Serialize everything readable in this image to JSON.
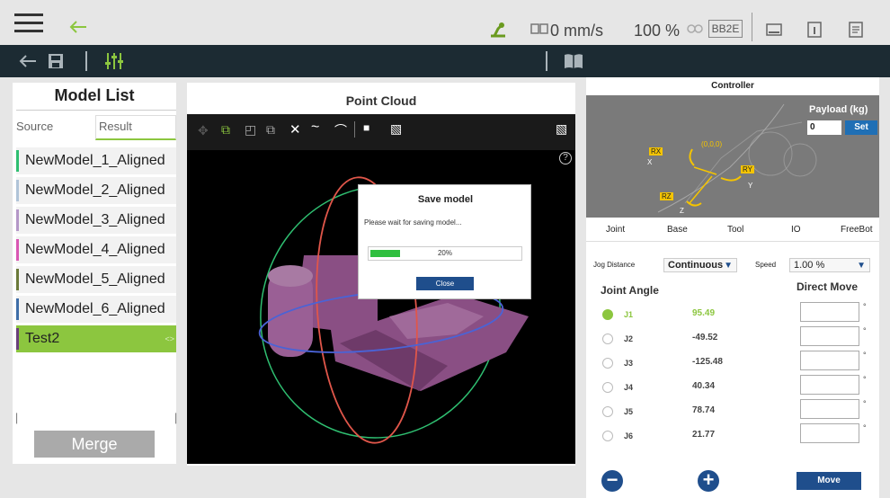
{
  "topbar": {
    "speed": "0 mm/s",
    "percent": "100 %",
    "device_id": "BB2E"
  },
  "left": {
    "title": "Model List",
    "tabs": [
      "Source",
      "Result"
    ],
    "models": [
      {
        "name": "NewModel_1_Aligned",
        "color": "#2fbf71"
      },
      {
        "name": "NewModel_2_Aligned",
        "color": "#b0c4d8"
      },
      {
        "name": "NewModel_3_Aligned",
        "color": "#b497c8"
      },
      {
        "name": "NewModel_4_Aligned",
        "color": "#d957b3"
      },
      {
        "name": "NewModel_5_Aligned",
        "color": "#6b7a3a"
      },
      {
        "name": "NewModel_6_Aligned",
        "color": "#3f6ea8"
      },
      {
        "name": "Test2",
        "color": "#6a3f7a"
      }
    ],
    "selected_tag": "<>",
    "merge_label": "Merge"
  },
  "pointcloud": {
    "title": "Point Cloud",
    "help_glyph": "?"
  },
  "dialog": {
    "title": "Save model",
    "message": "Please wait for saving model...",
    "progress": 0.2,
    "progress_text": "20%",
    "close_label": "Close"
  },
  "controller": {
    "title": "Controller",
    "payload_label": "Payload (kg)",
    "payload_value": "0",
    "set_label": "Set",
    "axis_labels": {
      "rx": "RX",
      "ry": "RY",
      "rz": "RZ",
      "x": "X",
      "y": "Y",
      "z": "Z",
      "origin": "(0,0,0)"
    },
    "tabs": [
      "Joint",
      "Base",
      "Tool",
      "IO",
      "FreeBot"
    ],
    "jog_distance_label": "Jog Distance",
    "jog_distance_value": "Continuous",
    "speed_label": "Speed",
    "speed_value": "1.00 %",
    "joint_angle_label": "Joint Angle",
    "direct_move_label": "Direct Move",
    "degree": "°",
    "joints": [
      {
        "name": "J1",
        "value": "95.49",
        "active": true
      },
      {
        "name": "J2",
        "value": "-49.52",
        "active": false
      },
      {
        "name": "J3",
        "value": "-125.48",
        "active": false
      },
      {
        "name": "J4",
        "value": "40.34",
        "active": false
      },
      {
        "name": "J5",
        "value": "78.74",
        "active": false
      },
      {
        "name": "J6",
        "value": "21.77",
        "active": false
      }
    ],
    "move_label": "Move"
  },
  "colors": {
    "accent_green": "#8cc63f",
    "dark_toolbar": "#1c2b33",
    "primary_blue": "#1f4e8c"
  }
}
